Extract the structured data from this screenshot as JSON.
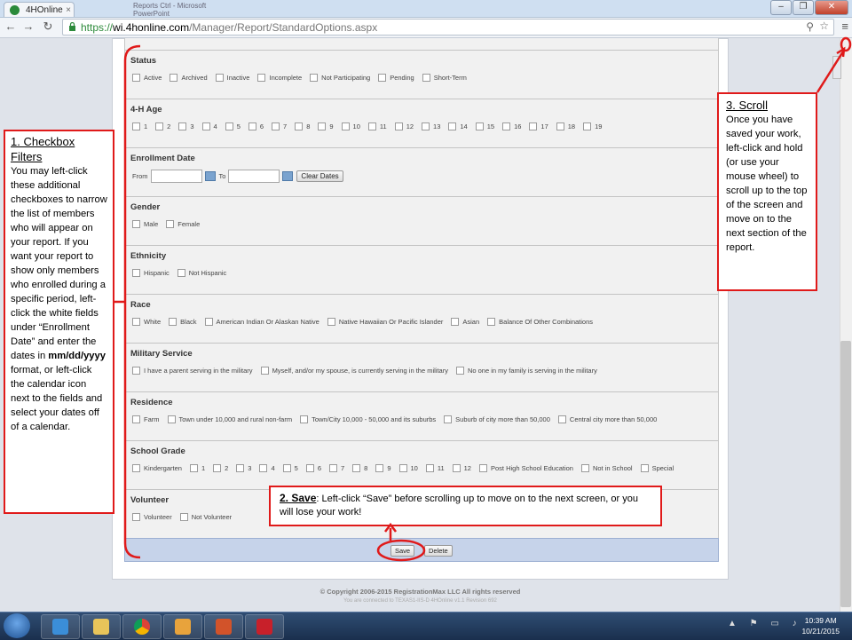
{
  "browser": {
    "tab_title": "4HOnline",
    "background_window_text": "Reports Ctrl - Microsoft PowerPoint",
    "url_prefix": "https://",
    "url_host": "wi.4honline.com",
    "url_path": "/Manager/Report/StandardOptions.aspx"
  },
  "sections": [
    {
      "title": "Status",
      "options": [
        "Active",
        "Archived",
        "Inactive",
        "Incomplete",
        "Not Participating",
        "Pending",
        "Short-Term"
      ]
    },
    {
      "title": "4-H Age",
      "options": [
        "1",
        "2",
        "3",
        "4",
        "5",
        "6",
        "7",
        "8",
        "9",
        "10",
        "11",
        "12",
        "13",
        "14",
        "15",
        "16",
        "17",
        "18",
        "19"
      ]
    },
    {
      "title": "Enrollment Date",
      "from_label": "From",
      "to_label": "To",
      "clear_label": "Clear Dates"
    },
    {
      "title": "Gender",
      "options": [
        "Male",
        "Female"
      ]
    },
    {
      "title": "Ethnicity",
      "options": [
        "Hispanic",
        "Not Hispanic"
      ]
    },
    {
      "title": "Race",
      "options": [
        "White",
        "Black",
        "American Indian Or Alaskan Native",
        "Native Hawaiian Or Pacific Islander",
        "Asian",
        "Balance Of Other Combinations"
      ]
    },
    {
      "title": "Military Service",
      "options": [
        "I have a parent serving in the military",
        "Myself, and/or my spouse, is currently serving in the military",
        "No one in my family is serving in the military"
      ]
    },
    {
      "title": "Residence",
      "options": [
        "Farm",
        "Town under 10,000 and rural non-farm",
        "Town/City 10,000 - 50,000 and its suburbs",
        "Suburb of city more than 50,000",
        "Central city more than 50,000"
      ]
    },
    {
      "title": "School Grade",
      "options": [
        "Kindergarten",
        "1",
        "2",
        "3",
        "4",
        "5",
        "6",
        "7",
        "8",
        "9",
        "10",
        "11",
        "12",
        "Post High School Education",
        "Not in School",
        "Special"
      ]
    },
    {
      "title": "Volunteer",
      "options": [
        "Volunteer",
        "Not Volunteer"
      ]
    }
  ],
  "actions": {
    "save": "Save",
    "delete": "Delete"
  },
  "footer": {
    "copyright": "© Copyright 2006-2015 RegistrationMax LLC All rights reserved",
    "connected": "You are connected to TEXAS1-IIS-D 4HOnline v1.1 Revision 692"
  },
  "callouts": {
    "c1_title": "1. Checkbox Filters",
    "c1_body_a": "You may left-click these additional checkboxes to narrow the list of members who will appear on your report. If you want your report to show only members who enrolled during a specific period, left-click the white fields under “Enrollment Date” and enter the dates in",
    "c1_bold": "mm/dd/yyyy",
    "c1_body_b": "format, or left-click the calendar icon next to the fields and select your dates off of a calendar.",
    "c2_title": "2. Save",
    "c2_body": ": Left-click “Save” before scrolling up to move on to the next screen, or you will lose your work!",
    "c3_title": "3. Scroll",
    "c3_body": "Once you have saved your work, left-click and hold (or use your mouse wheel) to scroll up to the top of the screen and move on to the next section of the report."
  },
  "taskbar": {
    "time": "10:39 AM",
    "date": "10/21/2015"
  },
  "colors": {
    "annotation": "#e01a1a",
    "footer_bar": "#c6d3ea",
    "taskbar": "#1a2f4d"
  }
}
